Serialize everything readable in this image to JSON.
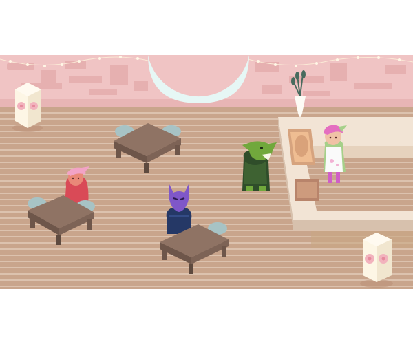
{
  "scene": {
    "type": "cafe-interior",
    "colors": {
      "floor": "#c9a58c",
      "floor_line": "#e2cbb9",
      "wall": "#f0c4c4",
      "wall_pattern": "#e3aaaa",
      "moon": "#e6f7f5",
      "table_top": "#8f7364",
      "table_side": "#6e564a",
      "stool": "#a7c3c5",
      "counter_top": "#f2e4d5",
      "counter_side": "#d7c1ad",
      "lantern": "#fdf6e5",
      "lantern_flower": "#f2b2bd"
    },
    "tables": [
      {
        "name": "table-top-left",
        "stools": 2
      },
      {
        "name": "table-left",
        "stools": 2
      },
      {
        "name": "table-center",
        "stools": 2
      }
    ],
    "characters": [
      {
        "name": "pink-haired-customer",
        "seat": "table-left",
        "color": "#d94a57"
      },
      {
        "name": "purple-horned-customer",
        "seat": "table-center",
        "color": "#7f57c9"
      },
      {
        "name": "green-goblin-customer",
        "seat": "standing",
        "color": "#71a83c"
      },
      {
        "name": "barista",
        "seat": "behind-counter",
        "color": "#e46ec0"
      }
    ],
    "lanterns": [
      "lantern-top-left",
      "lantern-bottom-right"
    ],
    "counter_items": [
      "vase-with-branches",
      "menu-board",
      "cutting-board"
    ]
  }
}
